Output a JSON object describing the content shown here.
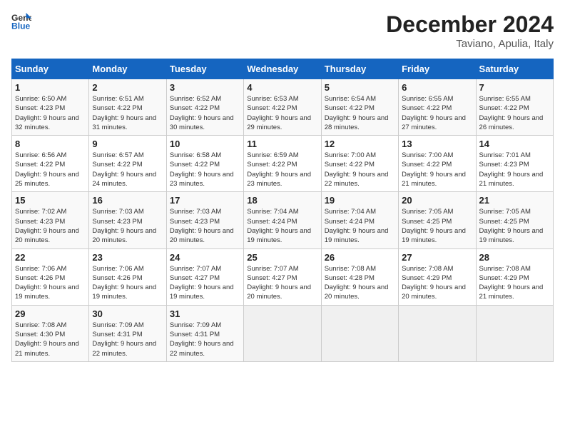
{
  "header": {
    "logo_line1": "General",
    "logo_line2": "Blue",
    "month": "December 2024",
    "location": "Taviano, Apulia, Italy"
  },
  "weekdays": [
    "Sunday",
    "Monday",
    "Tuesday",
    "Wednesday",
    "Thursday",
    "Friday",
    "Saturday"
  ],
  "weeks": [
    [
      {
        "day": "1",
        "sunrise": "Sunrise: 6:50 AM",
        "sunset": "Sunset: 4:23 PM",
        "daylight": "Daylight: 9 hours and 32 minutes."
      },
      {
        "day": "2",
        "sunrise": "Sunrise: 6:51 AM",
        "sunset": "Sunset: 4:22 PM",
        "daylight": "Daylight: 9 hours and 31 minutes."
      },
      {
        "day": "3",
        "sunrise": "Sunrise: 6:52 AM",
        "sunset": "Sunset: 4:22 PM",
        "daylight": "Daylight: 9 hours and 30 minutes."
      },
      {
        "day": "4",
        "sunrise": "Sunrise: 6:53 AM",
        "sunset": "Sunset: 4:22 PM",
        "daylight": "Daylight: 9 hours and 29 minutes."
      },
      {
        "day": "5",
        "sunrise": "Sunrise: 6:54 AM",
        "sunset": "Sunset: 4:22 PM",
        "daylight": "Daylight: 9 hours and 28 minutes."
      },
      {
        "day": "6",
        "sunrise": "Sunrise: 6:55 AM",
        "sunset": "Sunset: 4:22 PM",
        "daylight": "Daylight: 9 hours and 27 minutes."
      },
      {
        "day": "7",
        "sunrise": "Sunrise: 6:55 AM",
        "sunset": "Sunset: 4:22 PM",
        "daylight": "Daylight: 9 hours and 26 minutes."
      }
    ],
    [
      {
        "day": "8",
        "sunrise": "Sunrise: 6:56 AM",
        "sunset": "Sunset: 4:22 PM",
        "daylight": "Daylight: 9 hours and 25 minutes."
      },
      {
        "day": "9",
        "sunrise": "Sunrise: 6:57 AM",
        "sunset": "Sunset: 4:22 PM",
        "daylight": "Daylight: 9 hours and 24 minutes."
      },
      {
        "day": "10",
        "sunrise": "Sunrise: 6:58 AM",
        "sunset": "Sunset: 4:22 PM",
        "daylight": "Daylight: 9 hours and 23 minutes."
      },
      {
        "day": "11",
        "sunrise": "Sunrise: 6:59 AM",
        "sunset": "Sunset: 4:22 PM",
        "daylight": "Daylight: 9 hours and 23 minutes."
      },
      {
        "day": "12",
        "sunrise": "Sunrise: 7:00 AM",
        "sunset": "Sunset: 4:22 PM",
        "daylight": "Daylight: 9 hours and 22 minutes."
      },
      {
        "day": "13",
        "sunrise": "Sunrise: 7:00 AM",
        "sunset": "Sunset: 4:22 PM",
        "daylight": "Daylight: 9 hours and 21 minutes."
      },
      {
        "day": "14",
        "sunrise": "Sunrise: 7:01 AM",
        "sunset": "Sunset: 4:23 PM",
        "daylight": "Daylight: 9 hours and 21 minutes."
      }
    ],
    [
      {
        "day": "15",
        "sunrise": "Sunrise: 7:02 AM",
        "sunset": "Sunset: 4:23 PM",
        "daylight": "Daylight: 9 hours and 20 minutes."
      },
      {
        "day": "16",
        "sunrise": "Sunrise: 7:03 AM",
        "sunset": "Sunset: 4:23 PM",
        "daylight": "Daylight: 9 hours and 20 minutes."
      },
      {
        "day": "17",
        "sunrise": "Sunrise: 7:03 AM",
        "sunset": "Sunset: 4:23 PM",
        "daylight": "Daylight: 9 hours and 20 minutes."
      },
      {
        "day": "18",
        "sunrise": "Sunrise: 7:04 AM",
        "sunset": "Sunset: 4:24 PM",
        "daylight": "Daylight: 9 hours and 19 minutes."
      },
      {
        "day": "19",
        "sunrise": "Sunrise: 7:04 AM",
        "sunset": "Sunset: 4:24 PM",
        "daylight": "Daylight: 9 hours and 19 minutes."
      },
      {
        "day": "20",
        "sunrise": "Sunrise: 7:05 AM",
        "sunset": "Sunset: 4:25 PM",
        "daylight": "Daylight: 9 hours and 19 minutes."
      },
      {
        "day": "21",
        "sunrise": "Sunrise: 7:05 AM",
        "sunset": "Sunset: 4:25 PM",
        "daylight": "Daylight: 9 hours and 19 minutes."
      }
    ],
    [
      {
        "day": "22",
        "sunrise": "Sunrise: 7:06 AM",
        "sunset": "Sunset: 4:26 PM",
        "daylight": "Daylight: 9 hours and 19 minutes."
      },
      {
        "day": "23",
        "sunrise": "Sunrise: 7:06 AM",
        "sunset": "Sunset: 4:26 PM",
        "daylight": "Daylight: 9 hours and 19 minutes."
      },
      {
        "day": "24",
        "sunrise": "Sunrise: 7:07 AM",
        "sunset": "Sunset: 4:27 PM",
        "daylight": "Daylight: 9 hours and 19 minutes."
      },
      {
        "day": "25",
        "sunrise": "Sunrise: 7:07 AM",
        "sunset": "Sunset: 4:27 PM",
        "daylight": "Daylight: 9 hours and 20 minutes."
      },
      {
        "day": "26",
        "sunrise": "Sunrise: 7:08 AM",
        "sunset": "Sunset: 4:28 PM",
        "daylight": "Daylight: 9 hours and 20 minutes."
      },
      {
        "day": "27",
        "sunrise": "Sunrise: 7:08 AM",
        "sunset": "Sunset: 4:29 PM",
        "daylight": "Daylight: 9 hours and 20 minutes."
      },
      {
        "day": "28",
        "sunrise": "Sunrise: 7:08 AM",
        "sunset": "Sunset: 4:29 PM",
        "daylight": "Daylight: 9 hours and 21 minutes."
      }
    ],
    [
      {
        "day": "29",
        "sunrise": "Sunrise: 7:08 AM",
        "sunset": "Sunset: 4:30 PM",
        "daylight": "Daylight: 9 hours and 21 minutes."
      },
      {
        "day": "30",
        "sunrise": "Sunrise: 7:09 AM",
        "sunset": "Sunset: 4:31 PM",
        "daylight": "Daylight: 9 hours and 22 minutes."
      },
      {
        "day": "31",
        "sunrise": "Sunrise: 7:09 AM",
        "sunset": "Sunset: 4:31 PM",
        "daylight": "Daylight: 9 hours and 22 minutes."
      },
      null,
      null,
      null,
      null
    ]
  ]
}
